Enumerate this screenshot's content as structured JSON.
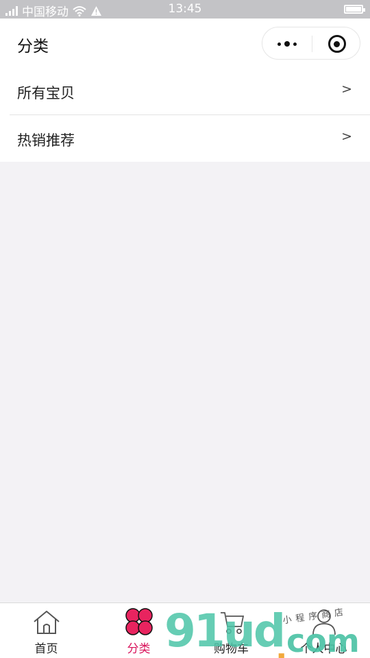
{
  "status_bar": {
    "carrier": "中国移动",
    "time": "13:45"
  },
  "header": {
    "title": "分类"
  },
  "list": [
    {
      "label": "所有宝贝",
      "arrow": ">"
    },
    {
      "label": "热销推荐",
      "arrow": ">"
    }
  ],
  "tabs": [
    {
      "label": "首页",
      "icon": "home-icon",
      "active": false
    },
    {
      "label": "分类",
      "icon": "clover-icon",
      "active": true
    },
    {
      "label": "购物车",
      "icon": "cart-icon",
      "active": false
    },
    {
      "label": "个人中心",
      "icon": "user-icon",
      "active": false
    }
  ],
  "watermark": {
    "digits": "91ud",
    "dot": ".",
    "suffix": "com",
    "tag": "小程序商店"
  },
  "colors": {
    "accent": "#d9165d",
    "background": "#f3f2f5",
    "status_bar": "#c3c3c6"
  }
}
